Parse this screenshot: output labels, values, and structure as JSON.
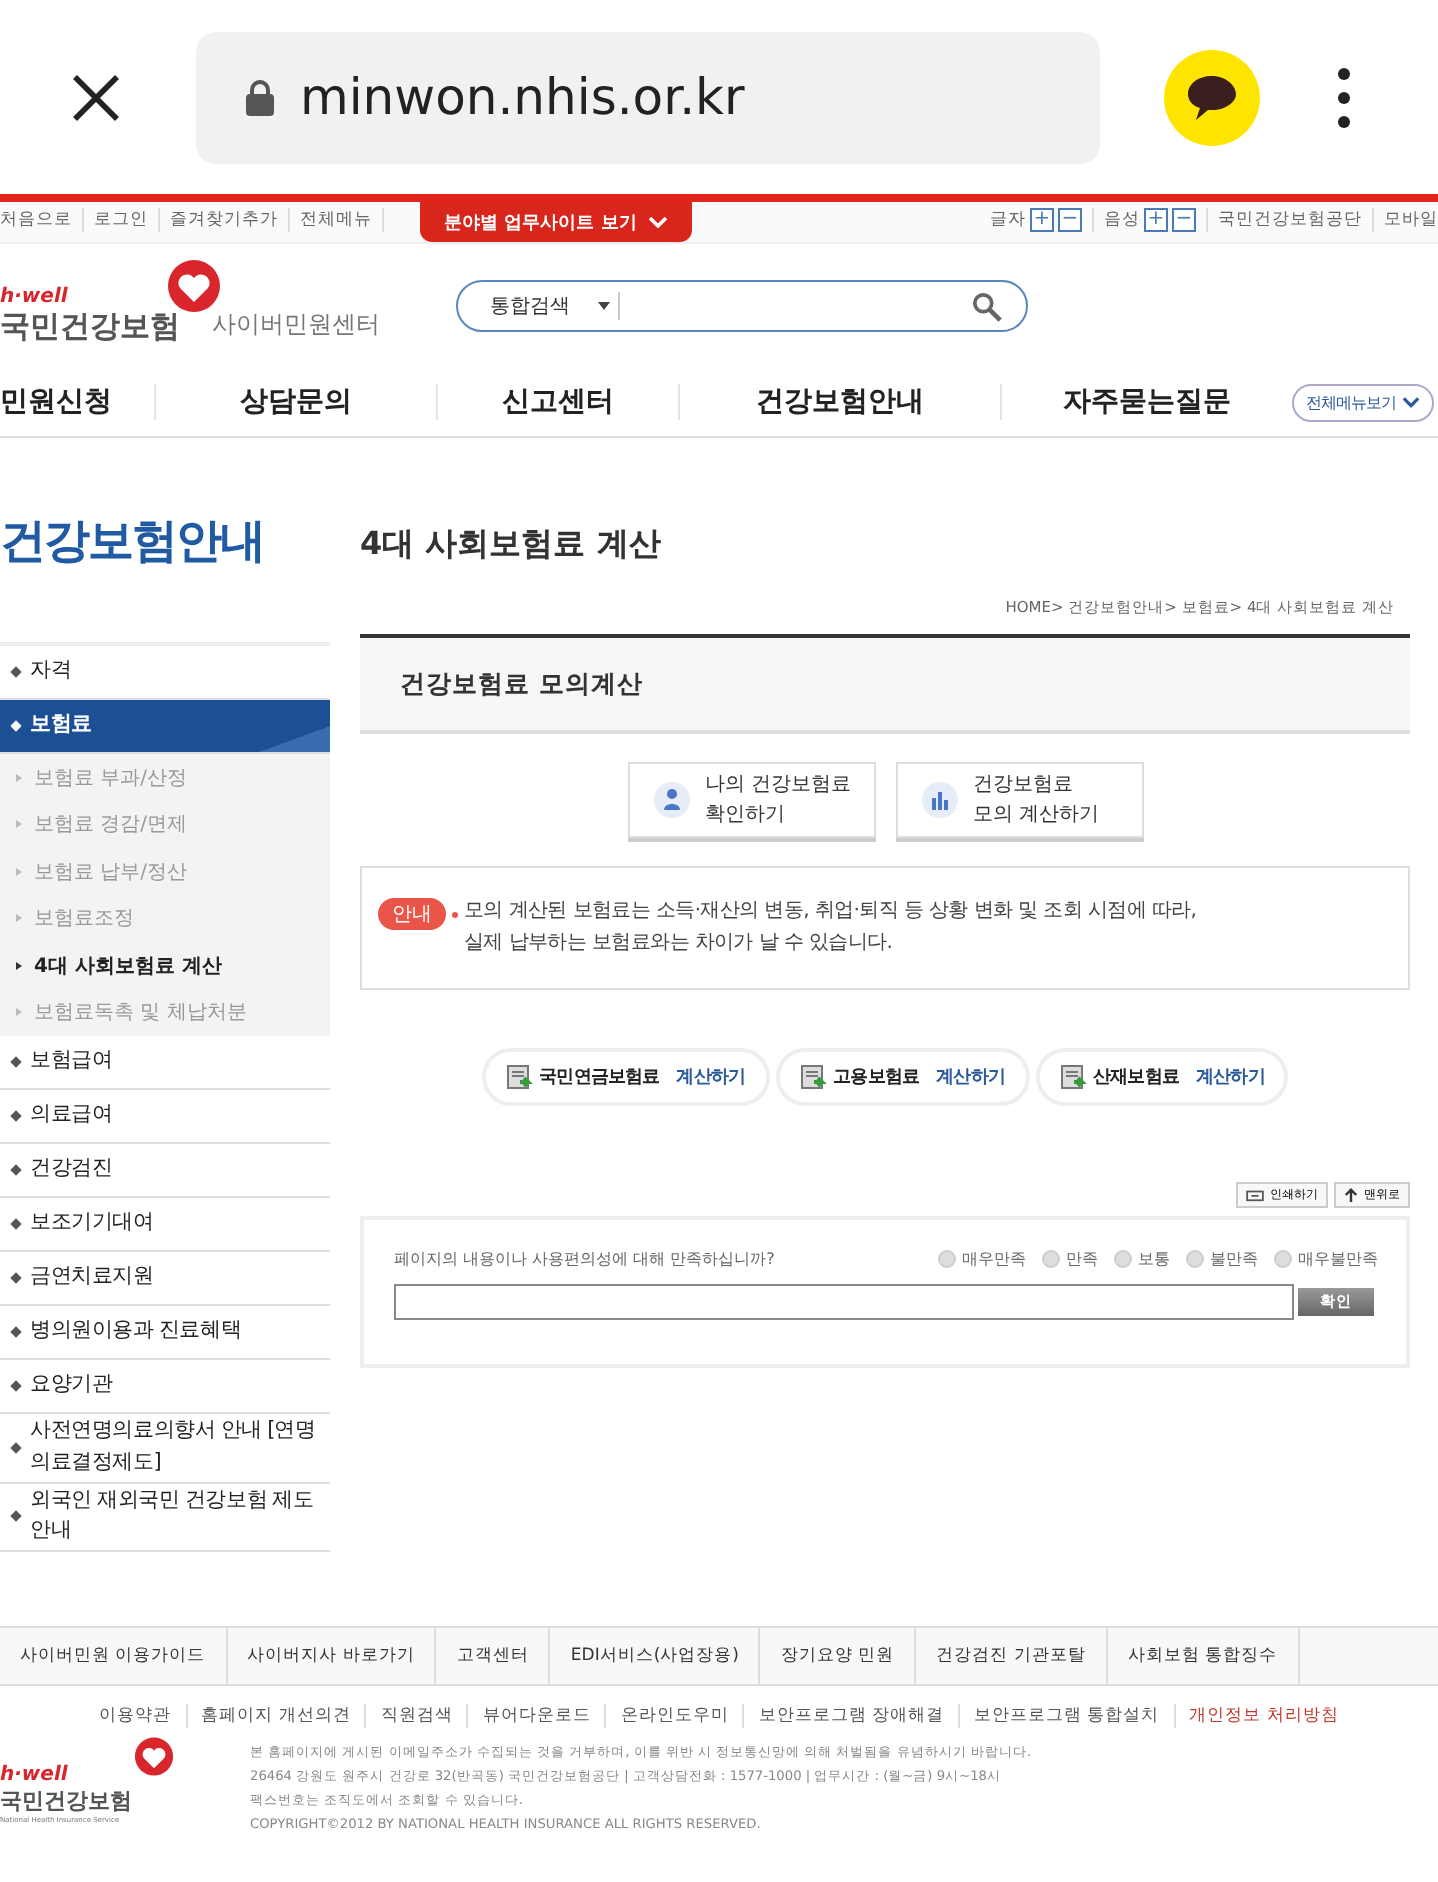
{
  "browser": {
    "url": "minwon.nhis.or.kr"
  },
  "util_bar": {
    "links": [
      "처음으로",
      "로그인",
      "즐겨찾기추가",
      "전체메뉴"
    ],
    "site_tab": "분야별 업무사이트 보기",
    "controls": [
      {
        "label": "글자",
        "plus": "+",
        "minus": "−"
      },
      {
        "label": "음성",
        "plus": "+",
        "minus": "−"
      }
    ],
    "right_links": [
      "국민건강보험공단",
      "모바일"
    ]
  },
  "header": {
    "logo_tag": "h·well",
    "logo_name": "국민건강보험",
    "logo_sub": "사이버민원센터",
    "search": {
      "scope": "통합검색"
    }
  },
  "nav": {
    "items": [
      "민원신청",
      "상담문의",
      "신고센터",
      "건강보험안내",
      "자주묻는질문"
    ],
    "all_menu": "전체메뉴보기"
  },
  "sidebar": {
    "title": "건강보험안내",
    "items": [
      {
        "label": "자격",
        "selected": false
      },
      {
        "label": "보험료",
        "selected": true,
        "children": [
          {
            "label": "보험료 부과/산정",
            "selected": false
          },
          {
            "label": "보험료 경감/면제",
            "selected": false
          },
          {
            "label": "보험료 납부/정산",
            "selected": false
          },
          {
            "label": "보험료조정",
            "selected": false
          },
          {
            "label": "4대 사회보험료 계산",
            "selected": true
          },
          {
            "label": "보험료독촉 및 체납처분",
            "selected": false
          }
        ]
      },
      {
        "label": "보험급여",
        "selected": false
      },
      {
        "label": "의료급여",
        "selected": false
      },
      {
        "label": "건강검진",
        "selected": false
      },
      {
        "label": "보조기기대여",
        "selected": false
      },
      {
        "label": "금연치료지원",
        "selected": false
      },
      {
        "label": "병의원이용과 진료혜택",
        "selected": false
      },
      {
        "label": "요양기관",
        "selected": false
      },
      {
        "label": "사전연명의료의향서 안내 [연명의료결정제도]",
        "selected": false
      },
      {
        "label": "외국인 재외국민 건강보험 제도 안내",
        "selected": false
      }
    ]
  },
  "page": {
    "title": "4대 사회보험료 계산",
    "breadcrumb": "HOME> 건강보험안내> 보험료> 4대 사회보험료 계산",
    "section_title": "건강보험료 모의계산",
    "actions": [
      {
        "kind": "person",
        "lines": [
          "나의 건강보험료",
          "확인하기"
        ]
      },
      {
        "kind": "chart",
        "lines": [
          "건강보험료",
          "모의 계산하기"
        ]
      }
    ],
    "notice": {
      "badge": "안내",
      "lines": [
        "모의 계산된 보험료는 소득·재산의 변동, 취업·퇴직 등 상황 변화 및 조회 시점에 따라,",
        "실제 납부하는 보험료와는 차이가 날 수 있습니다."
      ]
    },
    "calculators": [
      {
        "name": "국민연금보험료",
        "action": "계산하기"
      },
      {
        "name": "고용보험료",
        "action": "계산하기"
      },
      {
        "name": "산재보험료",
        "action": "계산하기"
      }
    ],
    "tools": [
      {
        "kind": "print",
        "label": "인쇄하기"
      },
      {
        "kind": "top",
        "label": "맨위로"
      }
    ],
    "survey": {
      "question": "페이지의 내용이나 사용편의성에 대해 만족하십니까?",
      "options": [
        {
          "label": "매우만족",
          "selected": false
        },
        {
          "label": "만족",
          "selected": false
        },
        {
          "label": "보통",
          "selected": false
        },
        {
          "label": "불만족",
          "selected": false
        },
        {
          "label": "매우불만족",
          "selected": false
        }
      ],
      "submit": "확인"
    }
  },
  "footer": {
    "links": [
      "사이버민원 이용가이드",
      "사이버지사 바로가기",
      "고객센터",
      "EDI서비스(사업장용)",
      "장기요양 민원",
      "건강검진 기관포탈",
      "사회보험 통합징수"
    ],
    "sub_links": [
      {
        "label": "이용약관",
        "color": "#555555"
      },
      {
        "label": "홈페이지 개선의견",
        "color": "#555555"
      },
      {
        "label": "직원검색",
        "color": "#555555"
      },
      {
        "label": "뷰어다운로드",
        "color": "#555555"
      },
      {
        "label": "온라인도우미",
        "color": "#555555"
      },
      {
        "label": "보안프로그램 장애해결",
        "color": "#555555"
      },
      {
        "label": "보안프로그램 통합설치",
        "color": "#555555"
      },
      {
        "label": "개인정보 처리방침",
        "color": "#c0392b"
      }
    ],
    "logo_tag": "h·well",
    "logo_name": "국민건강보험",
    "logo_en": "National Health Insurance Service",
    "info": [
      "본 홈페이지에 게시된 이메일주소가 수집되는 것을 거부하며, 이를 위반 시 정보통신망에 의해 처벌됨을 유념하시기 바랍니다.",
      "26464 강원도 원주시 건강로 32(반곡동) 국민건강보험공단 | 고객상담전화 : 1577-1000 | 업무시간 : (월~금) 9시~18시",
      "팩스번호는 조직도에서 조회할 수 있습니다.",
      "COPYRIGHT©2012 BY NATIONAL HEALTH INSURANCE ALL RIGHTS RESERVED."
    ]
  }
}
